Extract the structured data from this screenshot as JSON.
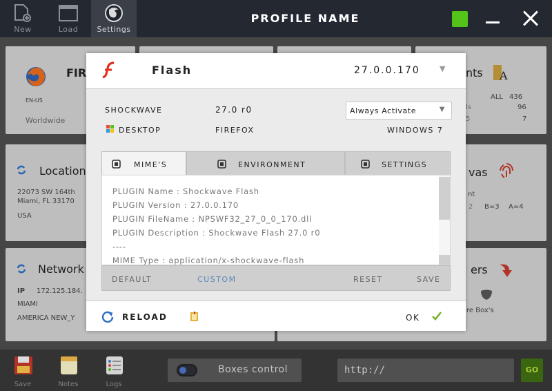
{
  "topbar": {
    "buttons": [
      {
        "label": "New",
        "icon": "new-file-icon"
      },
      {
        "label": "Load",
        "icon": "window-icon"
      },
      {
        "label": "Settings",
        "icon": "firefox-icon"
      }
    ],
    "title": "PROFILE NAME",
    "status_color": "#53c41a"
  },
  "background": {
    "browser_card": {
      "title": "FIR",
      "lang": "EN-US",
      "scope": "Worldwide"
    },
    "fonts_card": {
      "title": "nts",
      "all_label": "ALL",
      "all_value": "436",
      "row2_label": "ls",
      "row2_value": "96",
      "row3_label": "5",
      "row3_value": "7"
    },
    "location_card": {
      "title": "Location",
      "address1": "22073 SW 164th",
      "address2": "Miami, FL 33170",
      "country": "USA"
    },
    "canvas_card": {
      "title": "vas",
      "label1": "nt",
      "b_value": "B=3",
      "a_value": "A=4",
      "c_value": "2"
    },
    "network_card": {
      "title": "Network",
      "ip_label": "IP",
      "ip_value": "172.125.184.",
      "city": "MIAMI",
      "timezone": "AMERICA NEW_Y"
    },
    "headers_card": {
      "title": "ers",
      "caption": "re Box's"
    }
  },
  "modal": {
    "plugin_name": "Flash",
    "version": "27.0.0.170",
    "info": {
      "name_label": "SHOCKWAVE",
      "name_value": "27.0 r0",
      "activation": "Always Activate",
      "platform_label": "DESKTOP",
      "browser": "FIREFOX",
      "os": "WINDOWS 7"
    },
    "tabs": [
      {
        "label": "MIME'S",
        "active": true
      },
      {
        "label": "ENVIRONMENT",
        "active": false
      },
      {
        "label": "SETTINGS",
        "active": false
      }
    ],
    "content_lines": [
      "PLUGIN Name : Shockwave Flash",
      "PLUGIN Version : 27.0.0.170",
      "PLUGIN FileName : NPSWF32_27_0_0_170.dll",
      "PLUGIN Description : Shockwave Flash 27.0 r0",
      "----",
      "MIME Type : application/x-shockwave-flash"
    ],
    "actions": {
      "default": "DEFAULT",
      "custom": "CUSTOM",
      "reset": "RESET",
      "save": "SAVE"
    },
    "footer": {
      "reload": "RELOAD",
      "ok": "OK"
    }
  },
  "bottombar": {
    "buttons": [
      {
        "label": "Save",
        "icon": "floppy-icon"
      },
      {
        "label": "Notes",
        "icon": "notes-icon"
      },
      {
        "label": "Logs",
        "icon": "logs-icon"
      }
    ],
    "boxes_control": "Boxes control",
    "url_value": "http://",
    "go": "GO"
  },
  "colors": {
    "accent_green": "#53c41a",
    "custom_blue": "#5b88b8",
    "flash_red": "#e0321e"
  }
}
